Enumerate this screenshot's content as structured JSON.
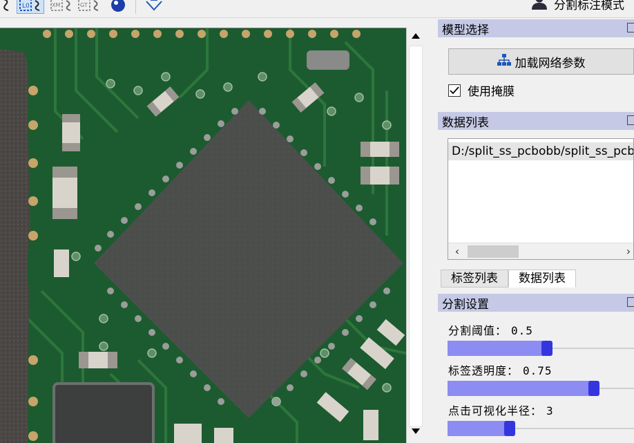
{
  "toolbar": {
    "mode_label": "分割标注模式",
    "icons": [
      "curve-tool-icon",
      "label-select-icon",
      "xml-export-icon",
      "segment-export-icon",
      "visibility-toggle-icon",
      "polygon-tool-icon"
    ]
  },
  "viewer": {
    "image_description_name": "pcb-board-image"
  },
  "model_dock": {
    "title": "模型选择",
    "load_button": "加载网络参数",
    "mask_label": "使用掩膜",
    "mask_checked": true
  },
  "data_dock": {
    "title": "数据列表",
    "items": [
      "D:/split_ss_pcbobb/split_ss_pcb"
    ]
  },
  "tabs": {
    "labels_tab": "标签列表",
    "data_tab": "数据列表"
  },
  "seg_dock": {
    "title": "分割设置",
    "threshold_label": "分割阈值：",
    "threshold_value": "0.5",
    "threshold_fraction": 0.5,
    "opacity_label": "标签透明度：",
    "opacity_value": "0.75",
    "opacity_fraction": 0.75,
    "radius_label": "点击可视化半径：",
    "radius_value": "3",
    "radius_fraction": 0.3
  },
  "colors": {
    "dock_title_bg": "#c5c9e6",
    "slider_fill": "#8c8cf2",
    "slider_handle": "#3535e0",
    "pcb_green": "#1b5a2e"
  }
}
